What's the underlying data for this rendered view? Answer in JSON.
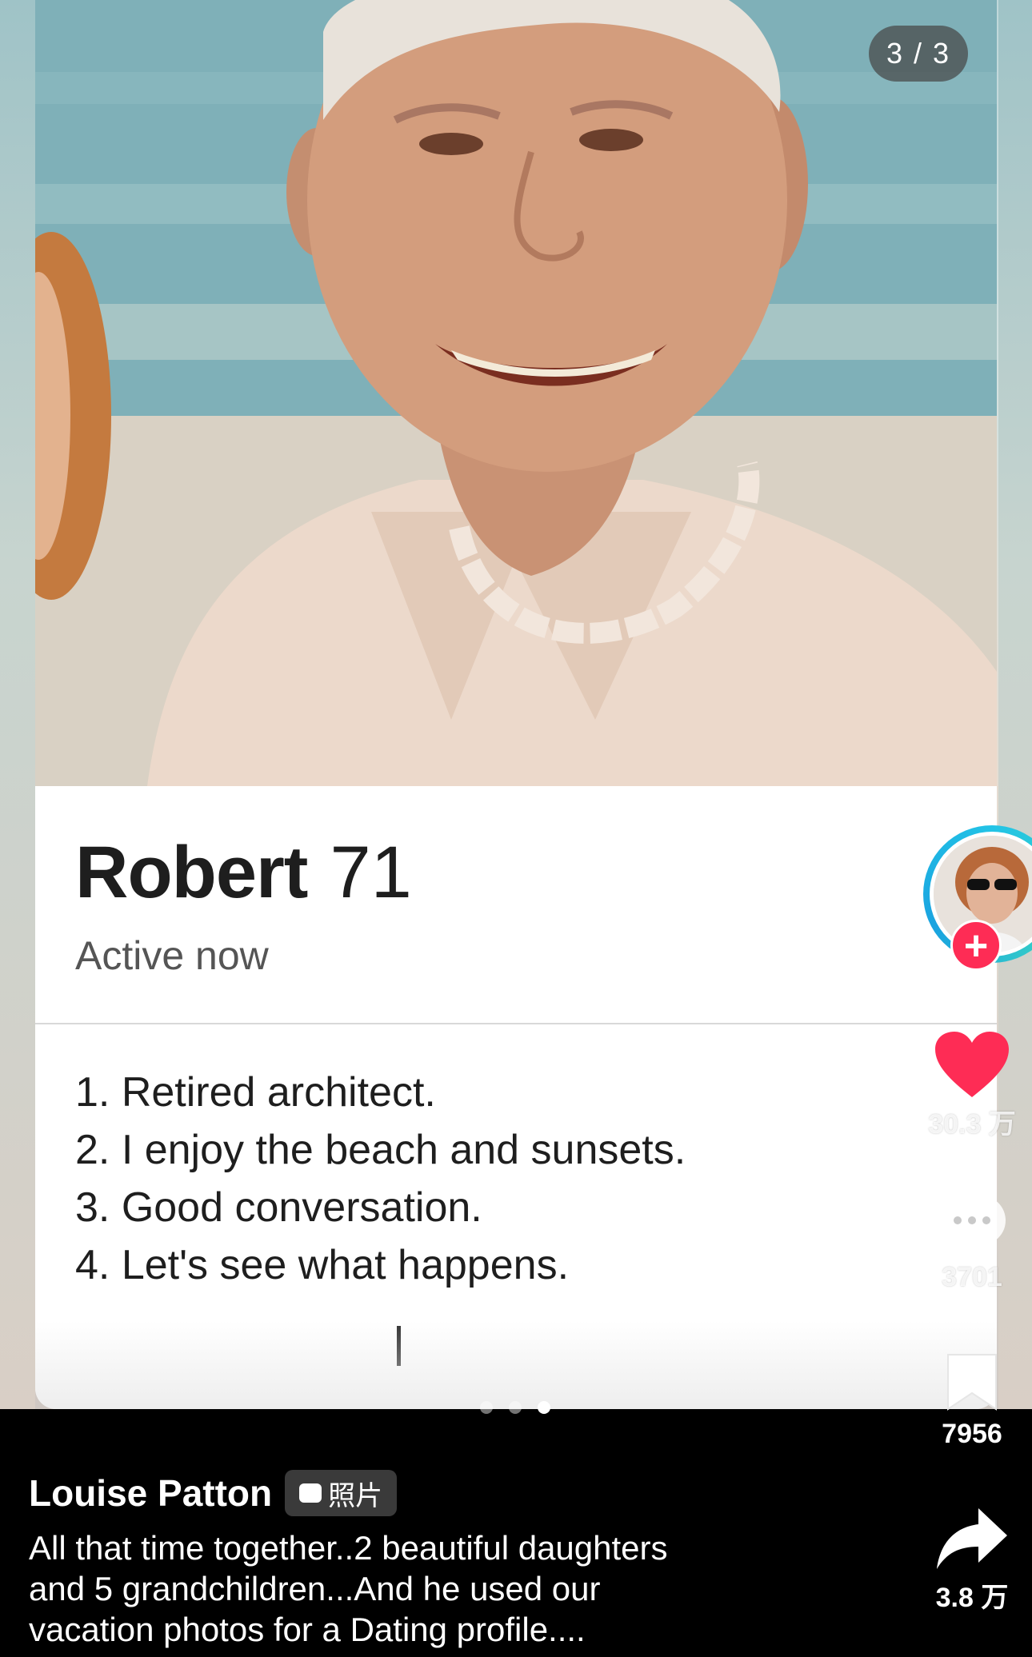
{
  "photo": {
    "counter": "3 / 3"
  },
  "profile": {
    "name": "Robert",
    "age": "71",
    "status": "Active now",
    "bio": [
      "1. Retired architect.",
      "2. I enjoy the beach and sunsets.",
      "3. Good conversation.",
      "4. Let's see what happens."
    ]
  },
  "carousel": {
    "page_count": 3,
    "active_index": 2
  },
  "rail": {
    "likes": "30.3 万",
    "comments": "3701",
    "favorites": "7956",
    "shares": "3.8 万",
    "follow_symbol": "+"
  },
  "caption": {
    "author": "Louise Patton",
    "badge_label": "照片",
    "text_lines": [
      "All that time together..2 beautiful daughters",
      "and 5 grandchildren...And he used our",
      "vacation photos for a Dating profile...."
    ]
  },
  "colors": {
    "like_red": "#fe2c55",
    "avatar_ring": "#22c3e6",
    "background": "#000000"
  },
  "icons": {
    "like": "heart-icon",
    "comment": "comment-bubble-icon",
    "favorite": "bookmark-icon",
    "share": "share-arrow-icon",
    "badge": "photo-badge-icon"
  }
}
